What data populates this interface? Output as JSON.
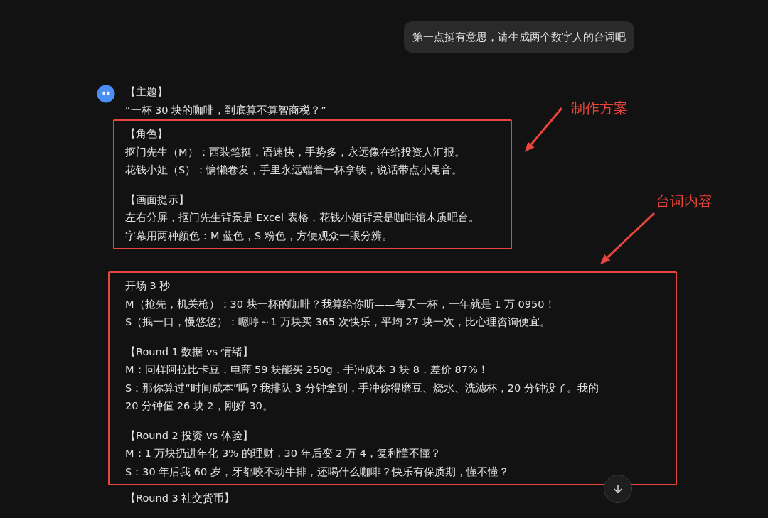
{
  "user_message": "第一点挺有意思，请生成两个数字人的台词吧",
  "reply": {
    "theme_heading": "【主题】",
    "theme_text": "“一杯 30 块的咖啡，到底算不算智商税？”",
    "plan_sections": [
      {
        "heading": "【角色】",
        "lines": [
          "抠门先生（M）：西装笔挺，语速快，手势多，永远像在给投资人汇报。",
          "花钱小姐（S）：慵懒卷发，手里永远端着一杯拿铁，说话带点小尾音。"
        ]
      },
      {
        "heading": "【画面提示】",
        "lines": [
          "左右分屏，抠门先生背景是 Excel 表格，花钱小姐背景是咖啡馆木质吧台。",
          "字幕用两种颜色：M 蓝色，S 粉色，方便观众一眼分辨。"
        ]
      }
    ],
    "script_sections": [
      {
        "heading": "开场 3 秒",
        "lines": [
          "M（抢先，机关枪）：30 块一杯的咖啡？我算给你听——每天一杯，一年就是 1 万 0950！",
          "S（抿一口，慢悠悠）：嗯哼～1 万块买 365 次快乐，平均 27 块一次，比心理咨询便宜。"
        ]
      },
      {
        "heading": "【Round 1 数据 vs 情绪】",
        "lines": [
          "M：同样阿拉比卡豆，电商 59 块能买 250g，手冲成本 3 块 8，差价 87%！",
          "S：那你算过“时间成本”吗？我排队 3 分钟拿到，手冲你得磨豆、烧水、洗滤杯，20 分钟没了。我的 20 分钟值 26 块 2，刚好 30。"
        ]
      },
      {
        "heading": "【Round 2 投资 vs 体验】",
        "lines": [
          "M：1 万块扔进年化 3% 的理财，30 年后变 2 万 4，复利懂不懂？",
          "S：30 年后我 60 岁，牙都咬不动牛排，还喝什么咖啡？快乐有保质期，懂不懂？"
        ]
      }
    ],
    "trailing_heading": "【Round 3 社交货币】"
  },
  "annotations": [
    {
      "label": "制作方案"
    },
    {
      "label": "台词内容"
    }
  ]
}
